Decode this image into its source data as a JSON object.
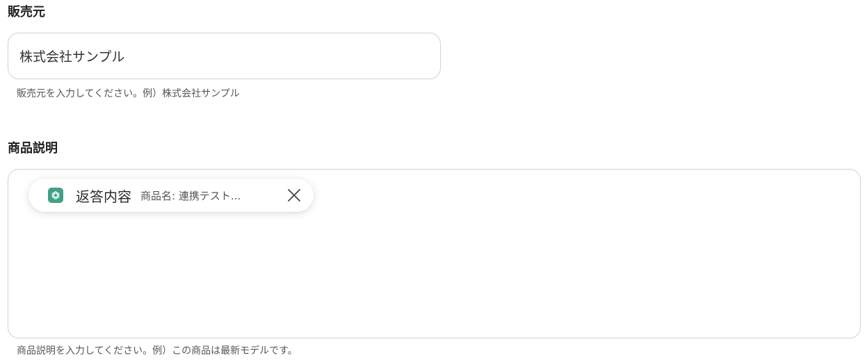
{
  "vendor": {
    "label": "販売元",
    "value": "株式会社サンプル",
    "helper": "販売元を入力してください。例）株式会社サンプル"
  },
  "description": {
    "label": "商品説明",
    "token": {
      "icon": "openai-icon",
      "title": "返答内容",
      "value": "商品名: 連携テスト..."
    },
    "helper": "商品説明を入力してください。例）この商品は最新モデルです。"
  },
  "colors": {
    "chip_icon_bg": "#3fa287",
    "border": "#d2d2d2"
  }
}
